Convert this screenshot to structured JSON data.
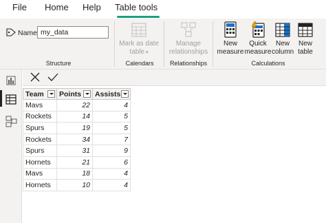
{
  "menu": {
    "items": [
      "File",
      "Home",
      "Help",
      "Table tools"
    ],
    "active_index": 3
  },
  "ribbon": {
    "structure": {
      "name_label": "Name",
      "name_value": "my_data",
      "group_label": "Structure"
    },
    "calendars": {
      "mark_as_date_table_line1": "Mark as date",
      "mark_as_date_table_line2": "table",
      "group_label": "Calendars"
    },
    "relationships": {
      "manage_line1": "Manage",
      "manage_line2": "relationships",
      "group_label": "Relationships"
    },
    "calculations": {
      "new_measure_line1": "New",
      "new_measure_line2": "measure",
      "quick_measure_line1": "Quick",
      "quick_measure_line2": "measure",
      "new_column_line1": "New",
      "new_column_line2": "column",
      "new_table_line1": "New",
      "new_table_line2": "table",
      "group_label": "Calculations"
    }
  },
  "table": {
    "headers": [
      "Team",
      "Points",
      "Assists"
    ],
    "rows": [
      [
        "Mavs",
        "22",
        "4"
      ],
      [
        "Rockets",
        "14",
        "5"
      ],
      [
        "Spurs",
        "19",
        "5"
      ],
      [
        "Rockets",
        "34",
        "7"
      ],
      [
        "Spurs",
        "31",
        "9"
      ],
      [
        "Hornets",
        "21",
        "6"
      ],
      [
        "Mavs",
        "18",
        "4"
      ],
      [
        "Hornets",
        "10",
        "4"
      ]
    ]
  },
  "colors": {
    "accent": "#1aa07a",
    "ribbon_bg": "#f3f2f1"
  }
}
